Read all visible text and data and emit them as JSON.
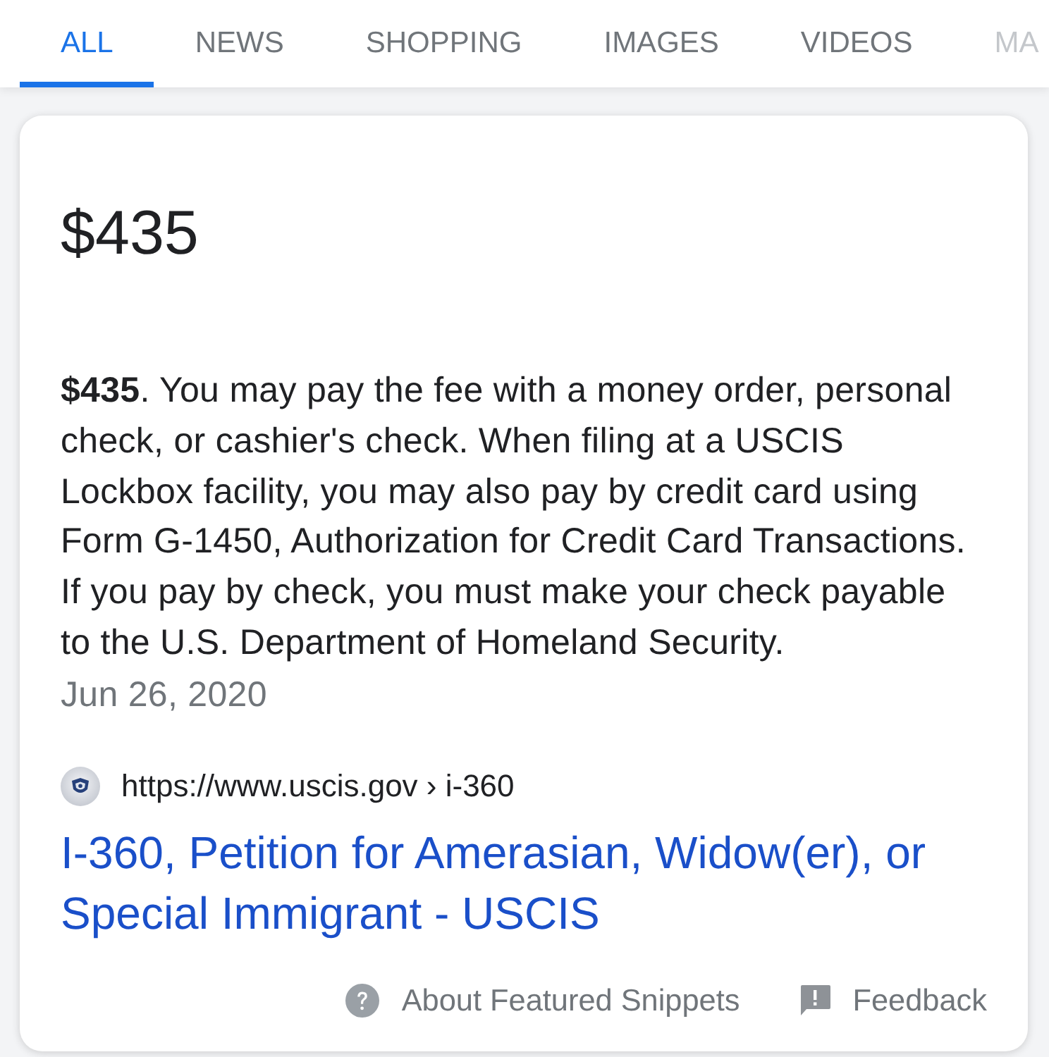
{
  "tabs": [
    {
      "label": "ALL",
      "selected": true
    },
    {
      "label": "NEWS",
      "selected": false
    },
    {
      "label": "SHOPPING",
      "selected": false
    },
    {
      "label": "IMAGES",
      "selected": false
    },
    {
      "label": "VIDEOS",
      "selected": false
    },
    {
      "label": "MA",
      "selected": false
    }
  ],
  "snippet": {
    "answer": "$435",
    "text": "**$435**. You may pay the fee with a money order, personal check, or cashier's check. When filing at a USCIS Lockbox facility, you may also pay by credit card using Form G-1450, Authorization for Credit Card Transactions. If you pay by check, you must make your check payable to the U.S. Department of Homeland Security.",
    "date": "Jun 26, 2020",
    "source": {
      "url": "https://www.uscis.gov › i-360",
      "title": "I-360, Petition for Amerasian, Widow(er), or Special Immigrant - USCIS"
    }
  },
  "footer": {
    "about": "About Featured Snippets",
    "feedback": "Feedback"
  }
}
